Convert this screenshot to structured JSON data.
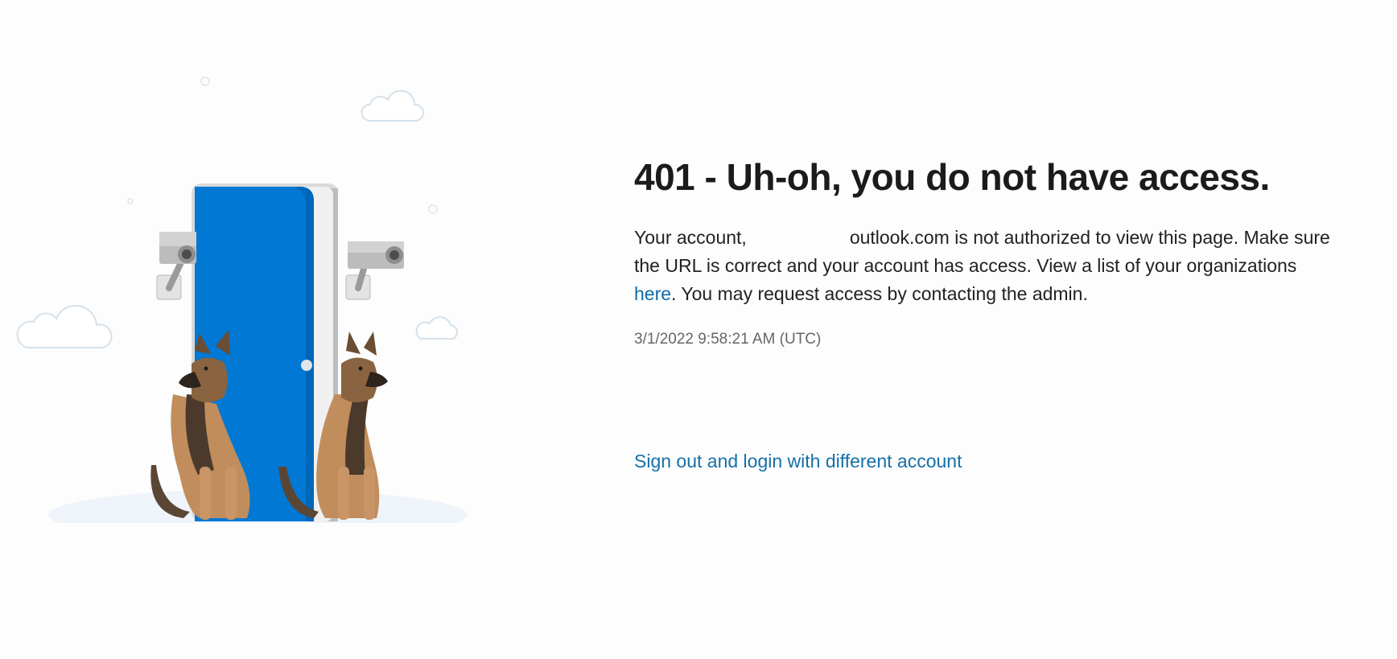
{
  "error": {
    "title": "401 - Uh-oh, you do not have access.",
    "message_part1": "Your account,",
    "message_part2": "outlook.com is not authorized to view this page. Make sure the URL is correct and your account has access. View a list of your organizations",
    "here_link": "here",
    "message_part3": ". You may request access by contacting the admin.",
    "timestamp": "3/1/2022 9:58:21 AM (UTC)"
  },
  "actions": {
    "signout_label": "Sign out and login with different account"
  },
  "colors": {
    "door_blue": "#0078d4",
    "link_blue": "#0f6aa8",
    "title": "#1b1b1b",
    "timestamp": "#666666"
  }
}
